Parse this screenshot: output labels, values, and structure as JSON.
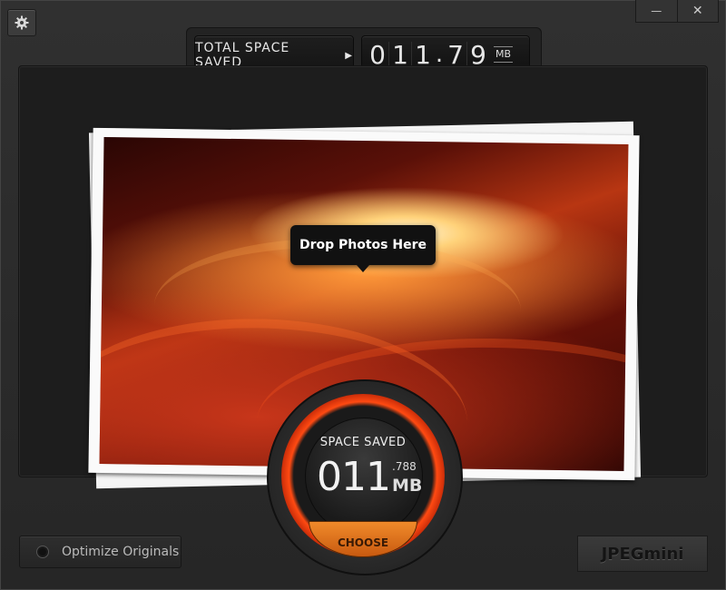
{
  "window": {
    "minimize_glyph": "—",
    "close_glyph": "✕"
  },
  "counter": {
    "label": "TOTAL SPACE SAVED",
    "arrow_glyph": "▶",
    "digits": [
      "0",
      "1",
      "1",
      ".",
      "7",
      "9"
    ],
    "unit": "MB"
  },
  "drop_area": {
    "tooltip": "Drop Photos Here"
  },
  "gauge": {
    "title": "SPACE SAVED",
    "value": "011",
    "decimal": ".788",
    "unit": "MB",
    "choose_label": "CHOOSE",
    "accent_color": "#ff4a12"
  },
  "footer": {
    "optimize_label": "Optimize Originals",
    "logo_text": "JPEGmini"
  }
}
